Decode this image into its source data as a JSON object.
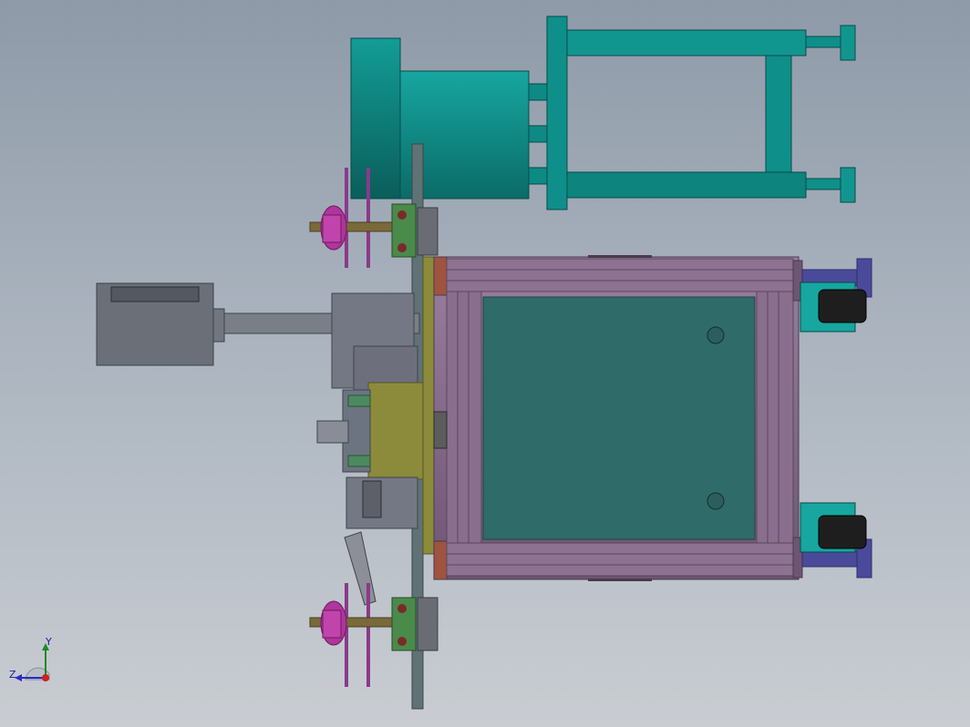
{
  "view": {
    "triad": {
      "y_label": "Y",
      "z_label": "Z"
    },
    "colors": {
      "background_top": "#8e9aa8",
      "background_bottom": "#c9cdd2",
      "teal": "#0f8f8a",
      "frame_purple": "#8a6c8c",
      "panel_green": "#2f6b69",
      "olive": "#8c8b3c",
      "grey": "#6b6f78",
      "magenta": "#b0359c",
      "navy": "#4a4a9a"
    }
  }
}
